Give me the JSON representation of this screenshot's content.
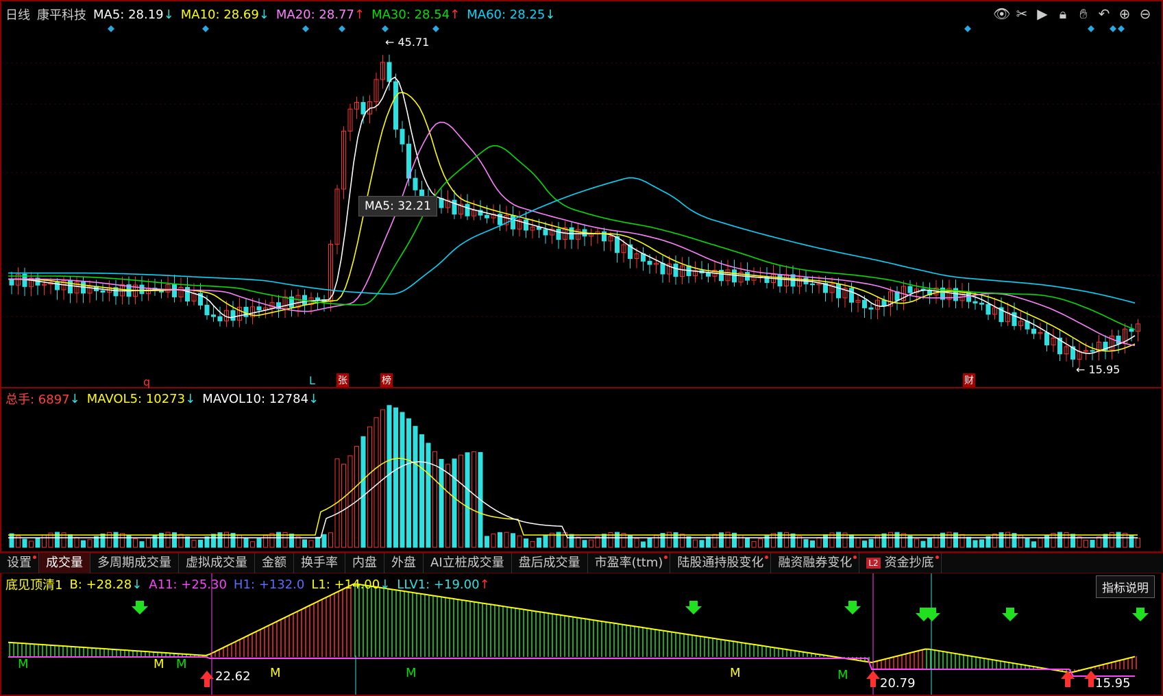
{
  "main": {
    "period": "日线",
    "stock_name": "康平科技",
    "ma": [
      {
        "label": "MA5: 28.19",
        "arrow": "↓",
        "color": "#ffffff"
      },
      {
        "label": "MA10: 28.69",
        "arrow": "↓",
        "color": "#ffff00"
      },
      {
        "label": "MA20: 28.77",
        "arrow": "↑",
        "color": "#ff80ff"
      },
      {
        "label": "MA30: 28.54",
        "arrow": "↑",
        "color": "#00e000"
      },
      {
        "label": "MA60: 28.25",
        "arrow": "↓",
        "color": "#00d8ff"
      }
    ],
    "high_label": "45.71",
    "low_label": "15.95",
    "tooltip": "MA5: 32.21",
    "event_marks": [
      "q",
      "L",
      "张",
      "榜",
      "财"
    ],
    "toolbar_icons": [
      "eye-icon",
      "scissors-icon",
      "play-icon",
      "lock-icon",
      "hand-icon",
      "undo-icon",
      "zoom-in-icon",
      "zoom-out-icon"
    ]
  },
  "volume": {
    "total_label": "总手: 6897",
    "total_arrow": "↓",
    "mavol5": "MAVOL5: 10273",
    "mavol5_arrow": "↓",
    "mavol10": "MAVOL10: 12784",
    "mavol10_arrow": "↓"
  },
  "tabs": [
    {
      "label": "设置",
      "dot": true
    },
    {
      "label": "成交量",
      "active": true
    },
    {
      "label": "多周期成交量"
    },
    {
      "label": "虚拟成交量"
    },
    {
      "label": "金额"
    },
    {
      "label": "换手率"
    },
    {
      "label": "内盘"
    },
    {
      "label": "外盘"
    },
    {
      "label": "AI立桩成交量"
    },
    {
      "label": "盘后成交量"
    },
    {
      "label": "市盈率(ttm)",
      "dot": true
    },
    {
      "label": "陆股通持股变化",
      "dot": true
    },
    {
      "label": "融资融券变化",
      "dot": true
    },
    {
      "label": "资金抄底",
      "l2": true,
      "dot": true
    }
  ],
  "indicator": {
    "name": "底见顶清1",
    "b": "B: +28.28",
    "b_arrow": "↓",
    "a11": "A11: +25.30",
    "h1": "H1: +132.0",
    "l1": "L1: +14.00",
    "l1_arrow": "↓",
    "llv1": "LLV1: +19.00",
    "llv1_arrow": "↑",
    "help_button": "指标说明",
    "labels": [
      "22.62",
      "20.79",
      "15.95"
    ],
    "m_label": "M"
  },
  "colors": {
    "up": "#ff3030",
    "down": "#30e0e0",
    "frame": "#8b0000"
  }
}
